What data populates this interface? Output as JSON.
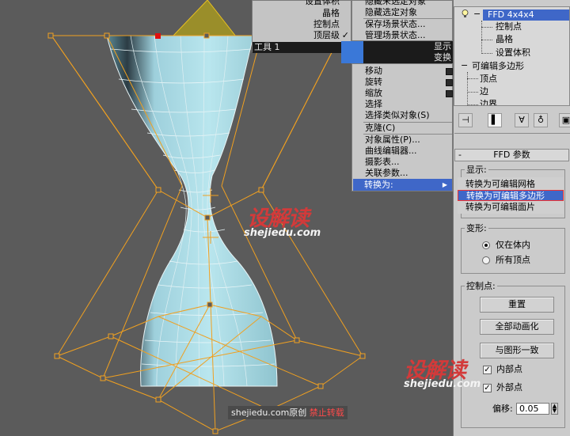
{
  "quad_menu": {
    "left_items": [
      "设置体积",
      "晶格",
      "控制点",
      "顶层级"
    ],
    "left_title": "工具 1",
    "right_top_items": [
      "隐藏未选定对象",
      "隐藏选定对象",
      "保存场景状态...",
      "管理场景状态..."
    ],
    "right_titles": [
      "显示",
      "变换"
    ],
    "transform_items": [
      "移动",
      "旋转",
      "缩放",
      "选择",
      "选择类似对象(S)",
      "克隆(C)",
      "对象属性(P)...",
      "曲线编辑器...",
      "摄影表...",
      "关联参数...",
      "转换为:"
    ],
    "check_mark": "✓",
    "submenu_arrow": "▶"
  },
  "modifier_stack": {
    "items": [
      {
        "label": "FFD 4x4x4",
        "selected": true
      },
      {
        "label": "控制点"
      },
      {
        "label": "晶格"
      },
      {
        "label": "设置体积"
      },
      {
        "label": "可编辑多边形"
      },
      {
        "label": "顶点"
      },
      {
        "label": "边"
      },
      {
        "label": "边界"
      }
    ],
    "expand_symbols": [
      "−",
      "+"
    ],
    "toolbar_icons": [
      "pin-stack-icon",
      "show-end-result-icon",
      "make-unique-icon",
      "remove-modifier-icon",
      "configure-sets-icon"
    ]
  },
  "ffd_panel": {
    "title": "FFD 参数",
    "collapse_symbol": "-",
    "display": {
      "label": "显示:",
      "convert_options": [
        "转换为可编辑网格",
        "转换为可编辑多边形",
        "转换为可编辑面片"
      ],
      "highlighted_index": 1
    },
    "deform": {
      "label": "变形:",
      "options": [
        "仅在体内",
        "所有顶点"
      ],
      "selected_index": 0
    },
    "control_points": {
      "label": "控制点:",
      "buttons": [
        "重置",
        "全部动画化",
        "与图形一致"
      ],
      "checkboxes": [
        {
          "label": "内部点",
          "checked": true
        },
        {
          "label": "外部点",
          "checked": true
        }
      ],
      "offset_label": "偏移:",
      "offset_value": "0.05"
    }
  },
  "watermarks": {
    "logo_text": "设解读",
    "url": "shejiedu.com",
    "notice_prefix": "shejiedu.com原创",
    "notice_red": "禁止转载"
  },
  "colors": {
    "mesh_fill": "#a7dbe3",
    "lattice": "#f0a020",
    "highlight": "#3f67c8",
    "watermark_red": "#d33a3a"
  }
}
